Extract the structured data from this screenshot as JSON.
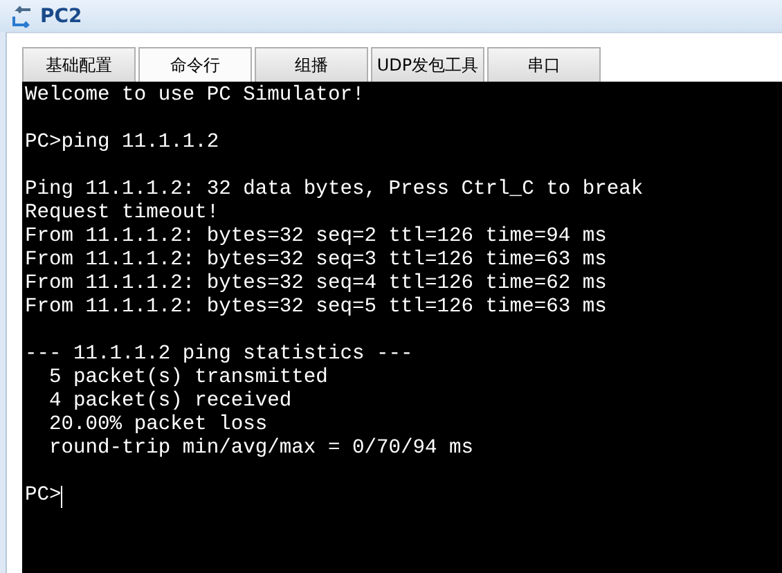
{
  "window": {
    "title": "PC2"
  },
  "tabs": [
    {
      "label": "基础配置",
      "selected": false
    },
    {
      "label": "命令行",
      "selected": true
    },
    {
      "label": "组播",
      "selected": false
    },
    {
      "label": "UDP发包工具",
      "selected": false
    },
    {
      "label": "串口",
      "selected": false
    }
  ],
  "terminal": {
    "blocks": [
      [
        "Welcome to use PC Simulator!"
      ],
      [
        "PC>ping 11.1.1.2"
      ],
      [
        "Ping 11.1.1.2: 32 data bytes, Press Ctrl_C to break",
        "Request timeout!",
        "From 11.1.1.2: bytes=32 seq=2 ttl=126 time=94 ms",
        "From 11.1.1.2: bytes=32 seq=3 ttl=126 time=63 ms",
        "From 11.1.1.2: bytes=32 seq=4 ttl=126 time=62 ms",
        "From 11.1.1.2: bytes=32 seq=5 ttl=126 time=63 ms"
      ],
      [
        "--- 11.1.1.2 ping statistics ---",
        "  5 packet(s) transmitted",
        "  4 packet(s) received",
        "  20.00% packet loss",
        "  round-trip min/avg/max = 0/70/94 ms"
      ]
    ],
    "prompt": "PC>"
  }
}
